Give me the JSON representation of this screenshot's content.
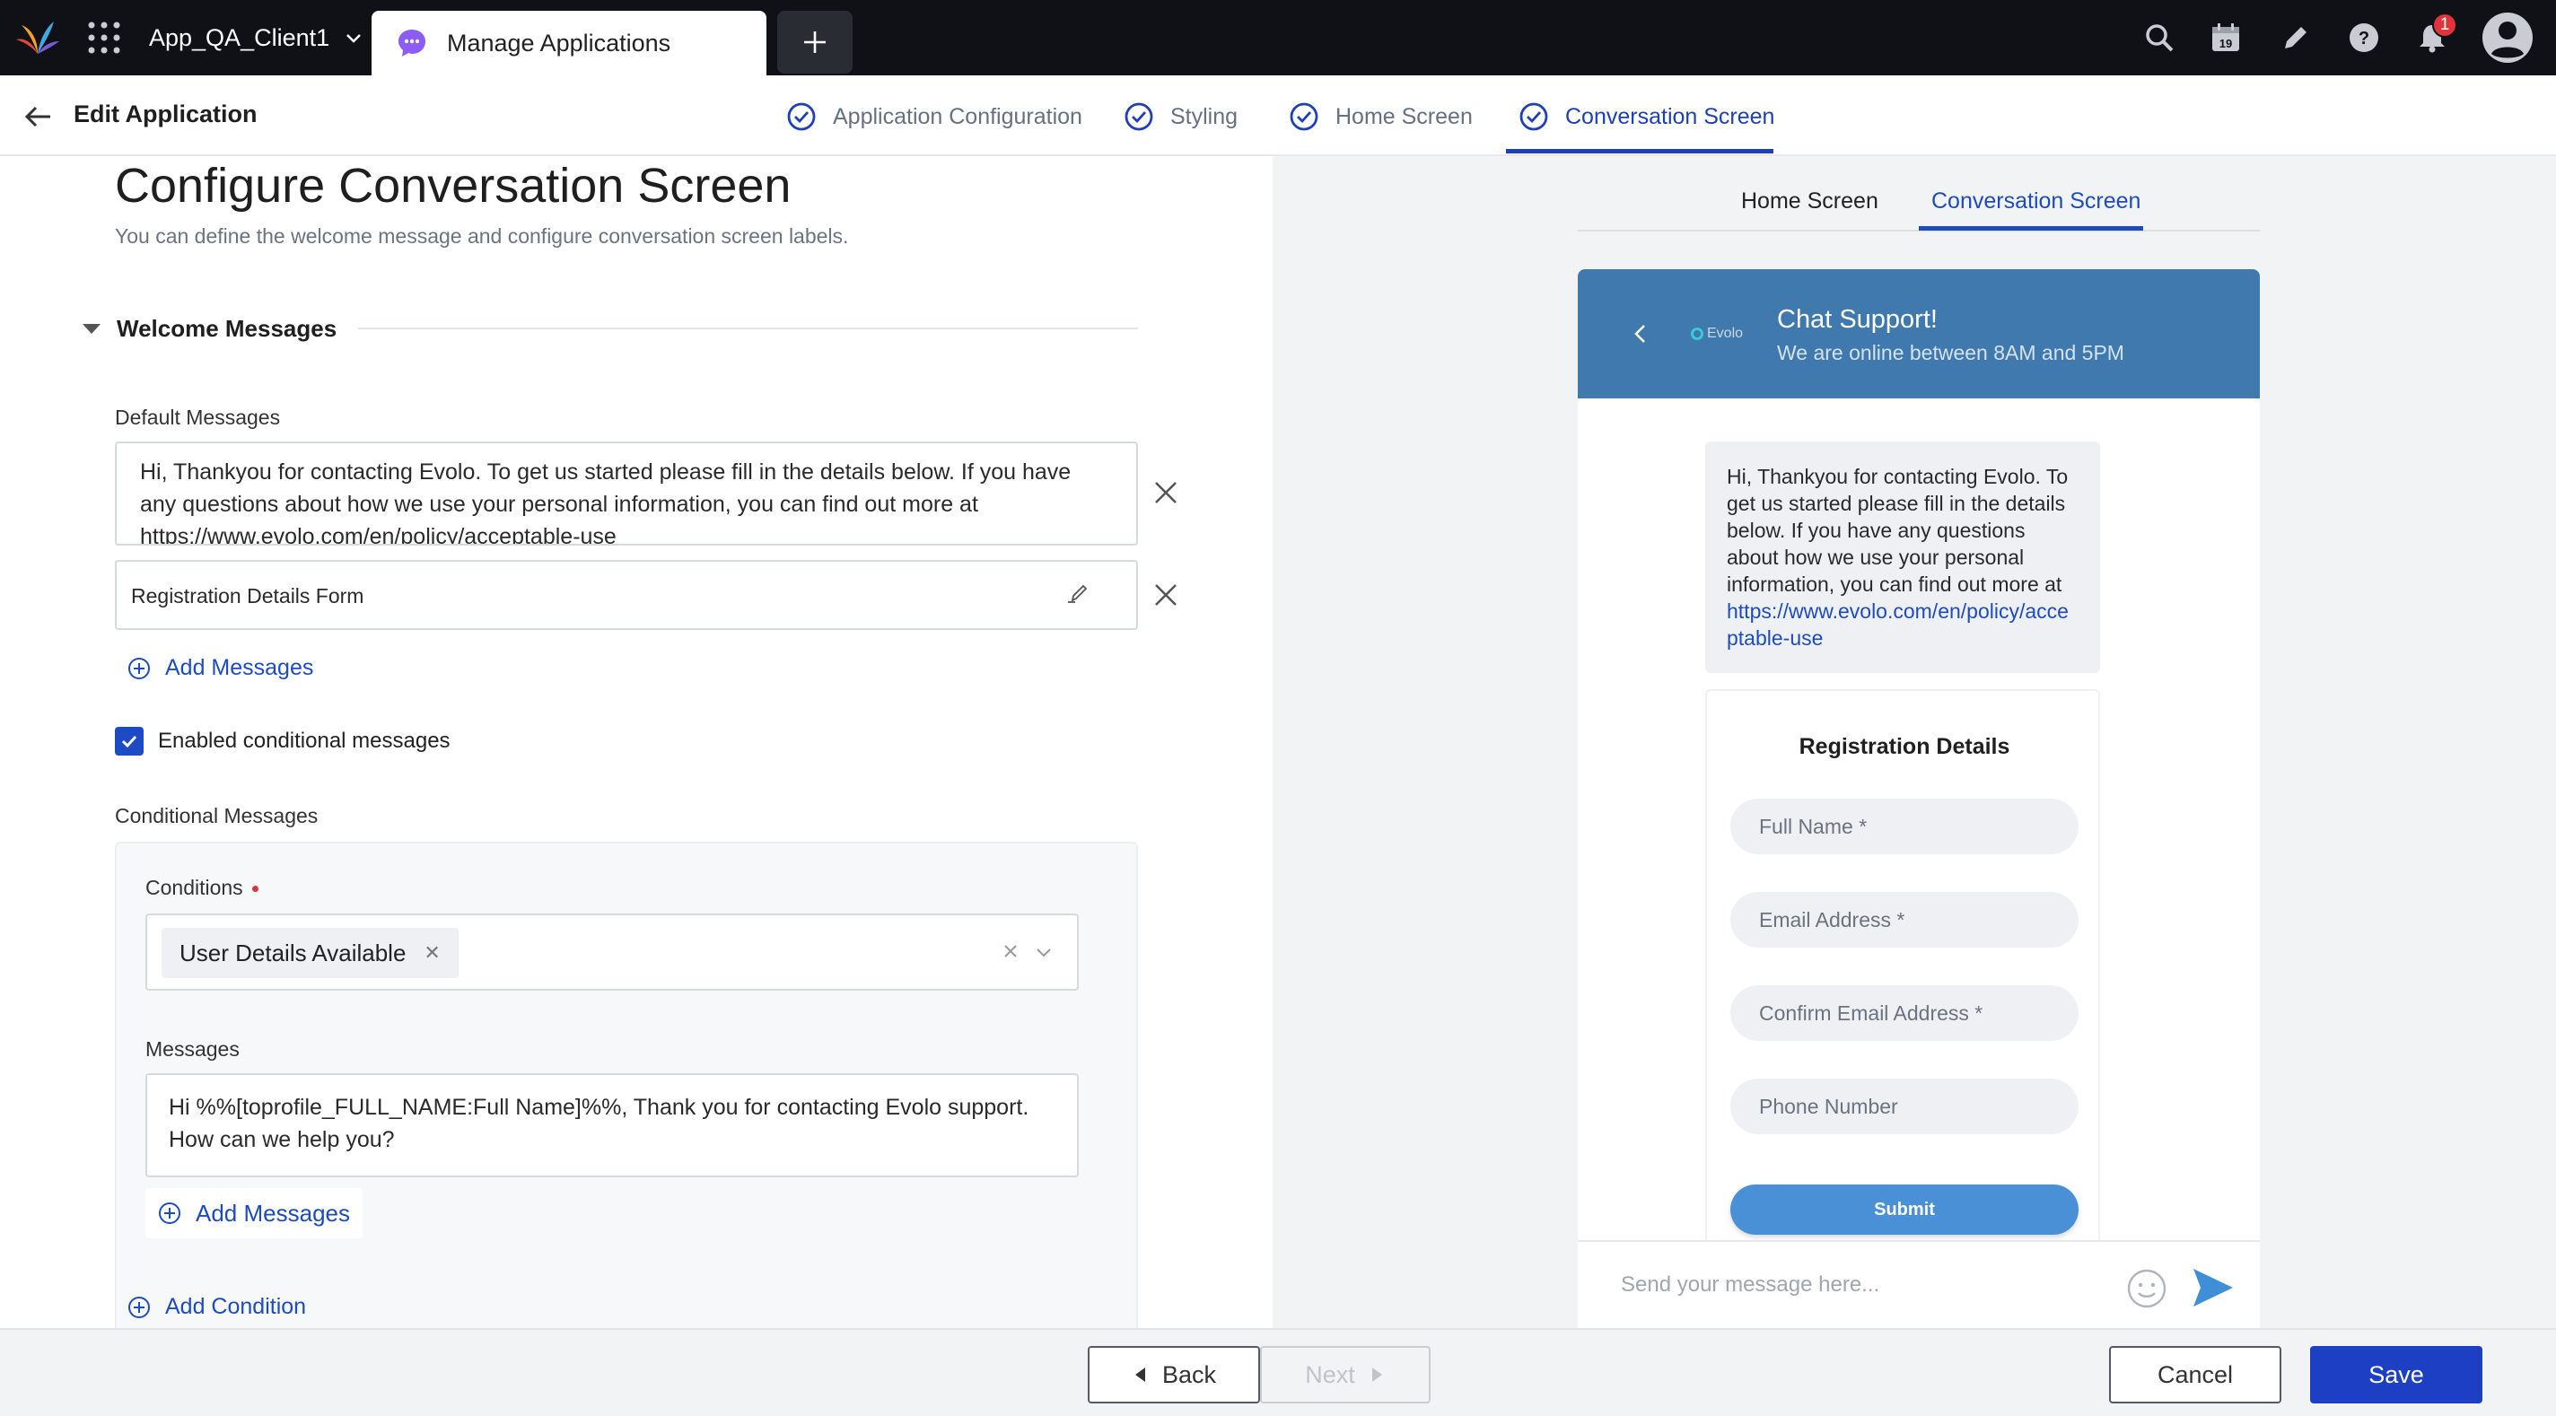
{
  "topbar": {
    "workspace": "App_QA_Client1",
    "active_tab": "Manage Applications",
    "notification_count": "1",
    "calendar_day": "19"
  },
  "subheader": {
    "title": "Edit Application",
    "steps": [
      {
        "label": "Application Configuration",
        "status": "done"
      },
      {
        "label": "Styling",
        "status": "done"
      },
      {
        "label": "Home Screen",
        "status": "done"
      },
      {
        "label": "Conversation Screen",
        "status": "active"
      }
    ]
  },
  "config": {
    "title": "Configure Conversation Screen",
    "subtitle": "You can define the welcome message and configure conversation screen labels.",
    "section_title": "Welcome Messages",
    "default_messages_label": "Default Messages",
    "default_message_text": "Hi, Thankyou for contacting Evolo. To get us started please fill in the details below. If you have any questions about how we use your personal information, you can find out more at https://www.evolo.com/en/policy/acceptable-use",
    "form_item": "Registration Details Form",
    "add_messages": "Add Messages",
    "conditional_checkbox_label": "Enabled conditional messages",
    "conditional_checked": true,
    "conditional_messages_label": "Conditional Messages",
    "conditions_label": "Conditions",
    "condition_chip": "User Details Available",
    "messages_label": "Messages",
    "conditional_message_text": "Hi %%[toprofile_FULL_NAME:Full Name]%%, Thank you for contacting Evolo support. How can we help you?",
    "add_messages_inner": "Add Messages",
    "add_condition": "Add Condition"
  },
  "preview": {
    "tabs": [
      "Home Screen",
      "Conversation Screen"
    ],
    "active_tab": "Conversation Screen",
    "brand": "Evolo",
    "header_title": "Chat Support!",
    "header_subtitle": "We are online between 8AM and 5PM",
    "bubble_text": "Hi, Thankyou for contacting Evolo. To get us started please fill in the details below. If you have any questions about how we use your personal information, you can find out more at",
    "bubble_url": "https://www.evolo.com/en/policy/acceptable-use",
    "form_title": "Registration Details",
    "fields": [
      "Full Name *",
      "Email Address *",
      "Confirm Email Address *",
      "Phone Number"
    ],
    "submit": "Submit",
    "composer_placeholder": "Send your message here..."
  },
  "footer": {
    "back": "Back",
    "next": "Next",
    "cancel": "Cancel",
    "save": "Save"
  },
  "colors": {
    "primary": "#1d3fc4",
    "link": "#1d4bc4",
    "chat_header": "#3f79ad",
    "submit": "#4a90d6",
    "topbar": "#0f1117"
  }
}
